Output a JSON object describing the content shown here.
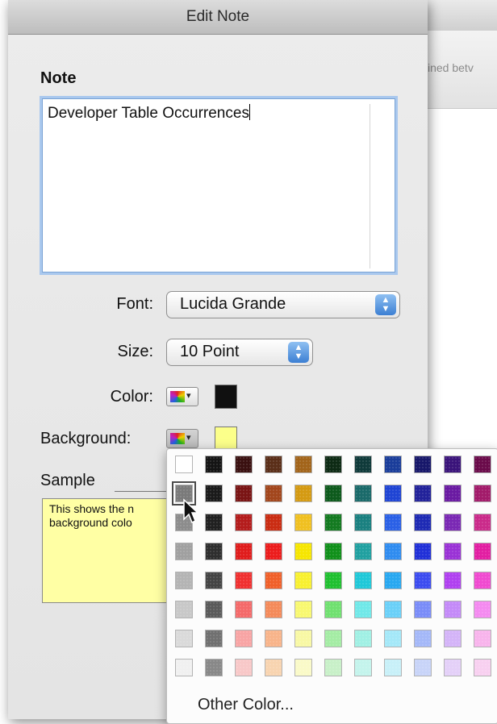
{
  "background_window": {
    "header_text": "ined betv"
  },
  "dialog": {
    "title": "Edit Note",
    "note_label": "Note",
    "note_text": "Developer Table Occurrences",
    "font_label": "Font:",
    "font_value": "Lucida Grande",
    "size_label": "Size:",
    "size_value": "10 Point",
    "color_label": "Color:",
    "background_label": "Background:",
    "sample_label": "Sample",
    "sample_text": "This shows the n\nbackground colo",
    "text_color": "#101010",
    "background_color": "#fcff8a"
  },
  "palette": {
    "other_color_label": "Other Color...",
    "selected": {
      "row": 1,
      "col": 0
    },
    "rows": [
      [
        "#ffffff",
        "#141414",
        "#3a1010",
        "#5a2e18",
        "#a2641a",
        "#0d2a14",
        "#0f3a3a",
        "#1a3d9a",
        "#17176a",
        "#3a137a",
        "#6a0a4a"
      ],
      [
        "#7a7a7a",
        "#1a1a1a",
        "#7a1414",
        "#a2461c",
        "#d49a12",
        "#0d5a1c",
        "#1a6a6a",
        "#1f44d4",
        "#22229a",
        "#6a1aa2",
        "#a21a6a"
      ],
      [
        "#8c8c8c",
        "#202020",
        "#b41c1c",
        "#ca2c12",
        "#f0c020",
        "#137a20",
        "#1a8080",
        "#2a60e6",
        "#1e2ab4",
        "#7a28b4",
        "#ca2a8a"
      ],
      [
        "#a0a0a0",
        "#2e2e2e",
        "#e01c1c",
        "#ec1c1c",
        "#f6e600",
        "#10901a",
        "#20a0a0",
        "#2f8cf0",
        "#2030d8",
        "#9a32d6",
        "#e21ea2"
      ],
      [
        "#b4b4b4",
        "#444444",
        "#f03030",
        "#f0602a",
        "#f8f030",
        "#20c030",
        "#20c8d8",
        "#28a8f0",
        "#3c4cf0",
        "#b040f0",
        "#f04ad0"
      ],
      [
        "#c8c8c8",
        "#5a5a5a",
        "#f46a6a",
        "#f48a5a",
        "#f8f870",
        "#70e070",
        "#70e8e8",
        "#6ad0f8",
        "#7a8cf8",
        "#c48af8",
        "#f48af0"
      ],
      [
        "#dadada",
        "#707070",
        "#f8a4a4",
        "#f8b48a",
        "#f8f8a4",
        "#a4eca4",
        "#a0f0e4",
        "#a4e8f8",
        "#a4b8f8",
        "#d4b4f8",
        "#f8b4ec"
      ],
      [
        "#f0f0f0",
        "#888888",
        "#f8c8c8",
        "#f8d4b0",
        "#fafac8",
        "#c8f0c8",
        "#c4f4ec",
        "#c8f0f8",
        "#c8d4f8",
        "#e4d0f8",
        "#f8d0f0"
      ]
    ]
  }
}
